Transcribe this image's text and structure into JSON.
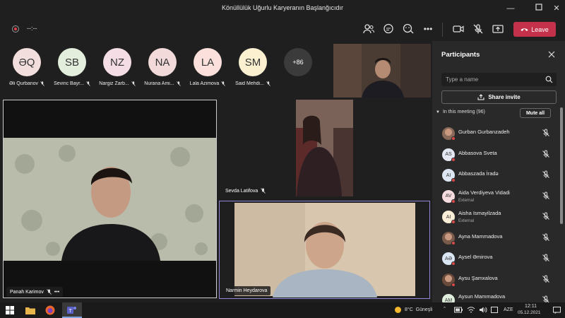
{
  "window": {
    "title": "Könüllülük Uğurlu Karyeranın Başlanğıcıdır"
  },
  "toolbar": {
    "timer": "--:--",
    "leave_label": "Leave"
  },
  "avatars": [
    {
      "initials": "ƏQ",
      "name": "Əli Qurbanov",
      "color": "#f3dede"
    },
    {
      "initials": "SB",
      "name": "Sevinc Bayr...",
      "color": "#e3eedc"
    },
    {
      "initials": "NZ",
      "name": "Nargiz Zarb...",
      "color": "#f5dde6"
    },
    {
      "initials": "NA",
      "name": "Nurana Ami...",
      "color": "#f2dada"
    },
    {
      "initials": "LA",
      "name": "Lala Azimova",
      "color": "#fbe0db"
    },
    {
      "initials": "SM",
      "name": "Said Mehdi...",
      "color": "#fbf0cf"
    },
    {
      "initials": "+86",
      "name": "",
      "color": "#3b3b3b"
    }
  ],
  "tiles": {
    "main_left": {
      "name": "Panah Karimov"
    },
    "top_right": {
      "name": "Sevda Latifova"
    },
    "bottom_right": {
      "name": "Narmin Heydarova"
    }
  },
  "participants": {
    "title": "Participants",
    "search_placeholder": "Type a name",
    "share_invite": "Share invite",
    "section_label": "In this meeting (96)",
    "mute_all": "Mute all",
    "list": [
      {
        "initials": "GG",
        "name": "Gurban Gurbanzadeh",
        "sub": "",
        "color": "#8a6a5a",
        "photo": true
      },
      {
        "initials": "AS",
        "name": "Abbasova Sveta",
        "sub": "",
        "color": "#e4e8f2"
      },
      {
        "initials": "AI",
        "name": "Abbaszada İradə",
        "sub": "",
        "color": "#dde7f3"
      },
      {
        "initials": "AV",
        "name": "Aida Verdiyeva Vidadi",
        "sub": "External",
        "color": "#f5dde0"
      },
      {
        "initials": "AI",
        "name": "Aisha Ismayilzada",
        "sub": "External",
        "color": "#fbeed6"
      },
      {
        "initials": "AM",
        "name": "Ayna Mammadova",
        "sub": "",
        "color": "#7a5a4a",
        "photo": true
      },
      {
        "initials": "AƏ",
        "name": "Aysel Əmirova",
        "sub": "",
        "color": "#dbe6f5"
      },
      {
        "initials": "AŞ",
        "name": "Aysu Şamxalova",
        "sub": "",
        "color": "#6a4a3a",
        "photo": true
      },
      {
        "initials": "AM",
        "name": "Aysun Mammadova",
        "sub": "External",
        "color": "#dfeedd"
      }
    ]
  },
  "taskbar": {
    "weather": "8°C  Güneşli",
    "lang": "AZE",
    "time": "12:11",
    "date": "05.12.2021"
  }
}
